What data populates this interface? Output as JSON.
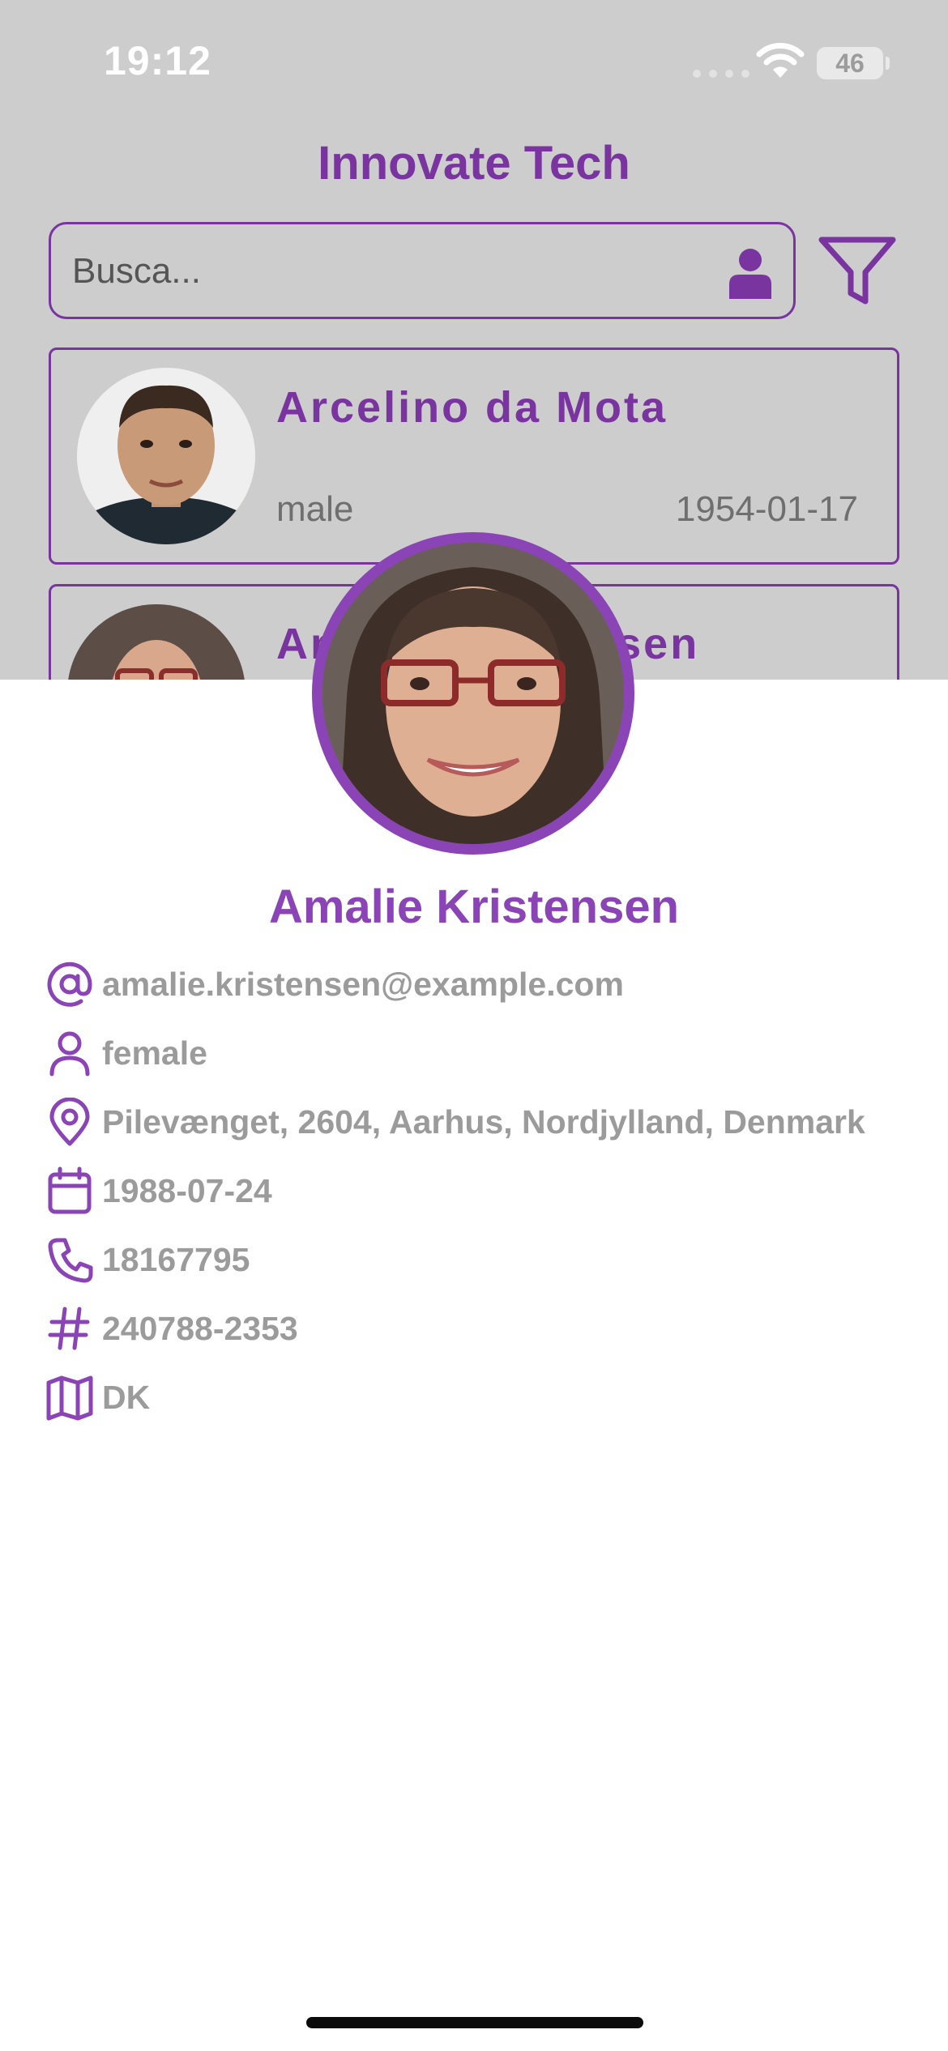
{
  "status_bar": {
    "time": "19:12",
    "battery": "46"
  },
  "header": {
    "title": "Innovate Tech"
  },
  "search": {
    "placeholder": "Busca..."
  },
  "list": [
    {
      "name": "Arcelino da Mota",
      "gender": "male",
      "dob": "1954-01-17"
    },
    {
      "name": "Amalie Kristensen"
    }
  ],
  "detail": {
    "name": "Amalie Kristensen",
    "email": "amalie.kristensen@example.com",
    "gender": "female",
    "address": "Pilevænget, 2604, Aarhus, Nordjylland, Denmark",
    "dob": "1988-07-24",
    "phone": "18167795",
    "id": "240788-2353",
    "nationality": "DK"
  },
  "colors": {
    "accent": "#7a34a0",
    "accent_light": "#8b44b6",
    "dim_background": "#cdcdcd",
    "detail_text": "#9b9b9b"
  },
  "icons": [
    "wifi-icon",
    "person-icon",
    "filter-icon",
    "at-icon",
    "user-outline-icon",
    "map-pin-icon",
    "calendar-icon",
    "phone-icon",
    "hash-icon",
    "map-icon"
  ]
}
